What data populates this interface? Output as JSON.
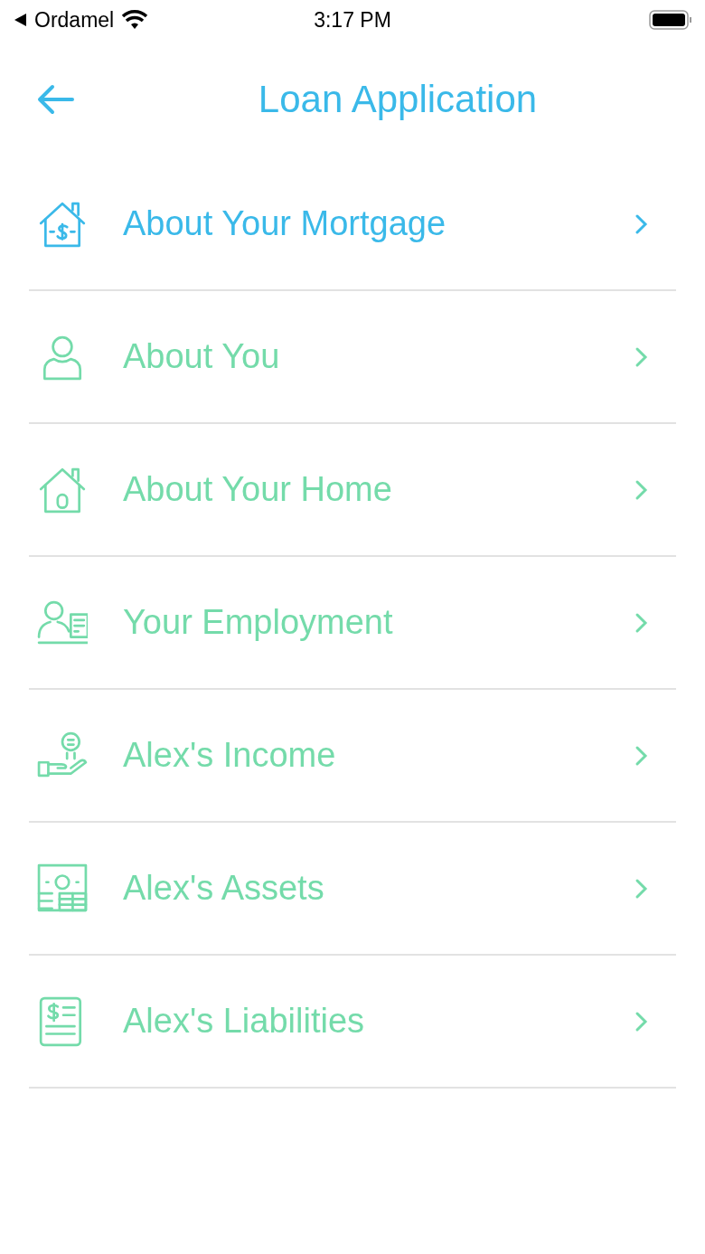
{
  "status_bar": {
    "back_app": "Ordamel",
    "time": "3:17 PM"
  },
  "header": {
    "title": "Loan Application"
  },
  "sections": [
    {
      "label": "About Your Mortgage",
      "kind": "mortgage",
      "selected": true
    },
    {
      "label": "About You",
      "kind": "person",
      "selected": false
    },
    {
      "label": "About Your Home",
      "kind": "home",
      "selected": false
    },
    {
      "label": "Your Employment",
      "kind": "employment",
      "selected": false
    },
    {
      "label": "Alex's Income",
      "kind": "income",
      "selected": false
    },
    {
      "label": "Alex's Assets",
      "kind": "assets",
      "selected": false
    },
    {
      "label": "Alex's Liabilities",
      "kind": "liabilities",
      "selected": false
    }
  ]
}
